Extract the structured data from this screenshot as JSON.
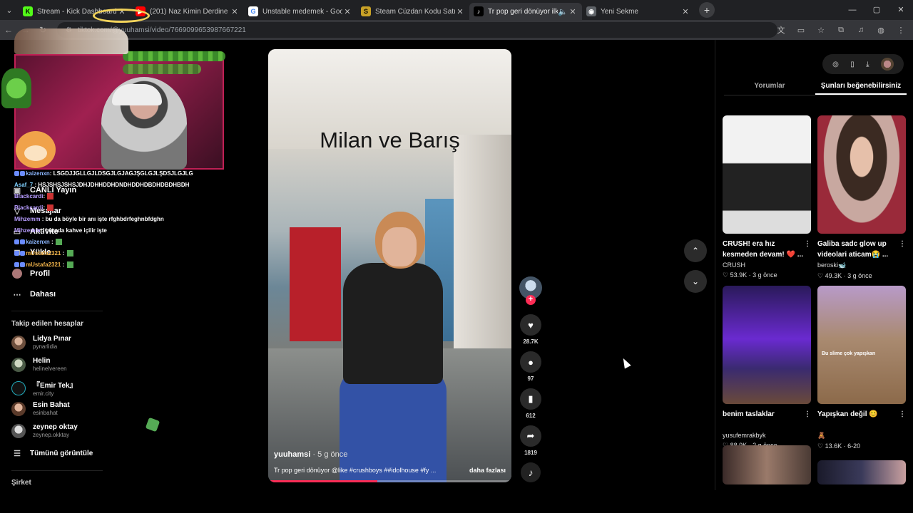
{
  "browser": {
    "tabs": [
      {
        "title": "Stream - Kick Dashboard",
        "favicon": "kick-icon",
        "color": "#53fc18"
      },
      {
        "title": "(201) Naz Kimin Derdine Koştu",
        "favicon": "youtube-icon",
        "color": "#ff0000"
      },
      {
        "title": "Unstable medemek - Google'da",
        "favicon": "google-icon",
        "color": "#4285f4"
      },
      {
        "title": "Steam Cüzdan Kodu Satın Al -",
        "favicon": "steam-icon",
        "color": "#c9a227"
      },
      {
        "title": "Tr pop geri dönüyor ilke",
        "favicon": "tiktok-icon",
        "color": "#ffffff"
      },
      {
        "title": "Yeni Sekme",
        "favicon": "chrome-icon",
        "color": "#9aa0a6"
      }
    ],
    "url": "tiktok.com/@yuuhamsi/video/7669099653987667221",
    "url_prefix": "tiktok.com"
  },
  "sidebar": {
    "items": [
      {
        "label": "CANLI Yayın",
        "icon": "live-icon"
      },
      {
        "label": "Mesajlar",
        "icon": "send-icon"
      },
      {
        "label": "Aktivite",
        "icon": "inbox-icon"
      },
      {
        "label": "Yükle",
        "icon": "upload-icon"
      },
      {
        "label": "Profil",
        "icon": "avatar-icon"
      },
      {
        "label": "Dahası",
        "icon": "more-icon"
      }
    ],
    "following_title": "Takip edilen hesaplar",
    "following": [
      {
        "name": "Lidya Pınar",
        "handle": "pynarlidia"
      },
      {
        "name": "Helin",
        "handle": "helinelvereen"
      },
      {
        "name": "『Emir Tek』",
        "handle": "emir.city"
      },
      {
        "name": "Esin Bahat",
        "handle": "esinbahat"
      },
      {
        "name": "zeynep oktay",
        "handle": "zeynep.okktay"
      }
    ],
    "see_all": "Tümünü görüntüle",
    "company": "Şirket"
  },
  "chat": [
    {
      "user": "kaizenxn",
      "msg": ": LSGDJJGLLGJLDSGJLGJAGJŞGLGJLŞDSJLGJLG"
    },
    {
      "user": "Asaf_7",
      "msg": ": HSJSHSJSHSJDHJDHHDDHDNDHDDHDBDHDBDHBDH"
    },
    {
      "user": "Blackcardi",
      "msg": ":"
    },
    {
      "user": "Blackcardi",
      "msg": ":"
    },
    {
      "user": "Mihzemm",
      "msg": ": bu da böyle bir anı işte rfghbdrfeghnbfdghn"
    },
    {
      "user": "Mihzemm",
      "msg": ": burada kahve içilir işte"
    },
    {
      "user": "kaizenxn",
      "msg": ":"
    },
    {
      "user": "mUstafa2321",
      "msg": ":"
    },
    {
      "user": "mUstafa2321",
      "msg": ":"
    }
  ],
  "video": {
    "overlay_text": "Milan ve Barış",
    "username": "yuuhamsi",
    "time": "· 5 g önce",
    "description": "Tr pop geri dönüyor @like #crushboys ##idolhouse #fy ...",
    "more": "daha fazlası",
    "progress": 0.45
  },
  "actions": {
    "likes": "28.7K",
    "comments": "97",
    "saves": "612",
    "shares": "1819"
  },
  "right_panel": {
    "tabs": [
      "Yorumlar",
      "Şunları beğenebilirsiniz"
    ],
    "active_tab": 1,
    "cards": [
      {
        "title": "CRUSH! era hız kesmeden devam! ❤️ ...",
        "author": "CRUSH",
        "stats": "♡ 53.9K · 3 g önce"
      },
      {
        "title": "Galiba sadc glow up videolari aticam😭 ...",
        "author": "beroski🐋",
        "stats": "♡ 49.3K · 3 g önce"
      },
      {
        "title": "benim taslaklar",
        "author": "yusufemrakbyk",
        "stats": "♡ 88.9K · 2 g önce"
      },
      {
        "title": "Yapışkan değil 😊",
        "author": "🧸",
        "stats": "♡ 13.6K · 6-20",
        "thumb_text": "Bu slime çok yapışkan"
      }
    ]
  }
}
